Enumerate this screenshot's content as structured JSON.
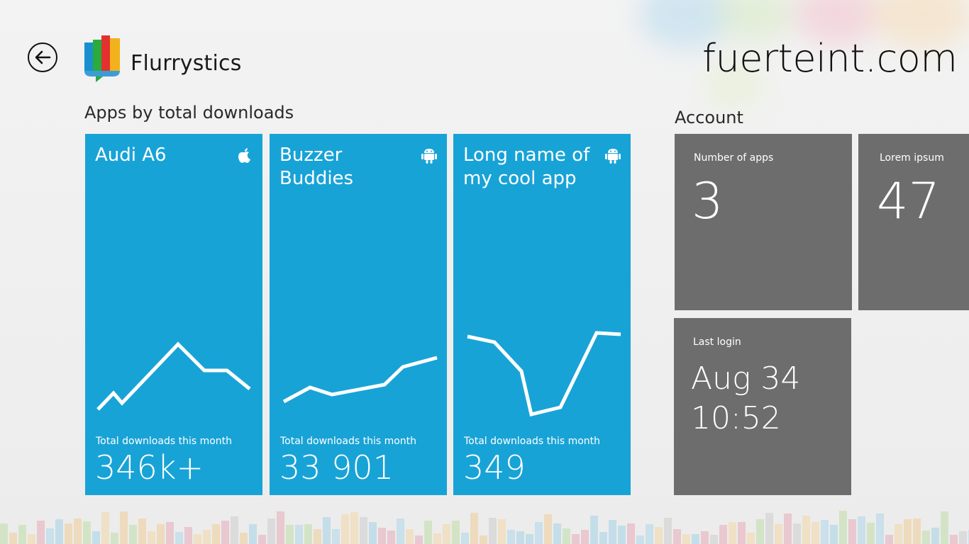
{
  "header": {
    "app_title": "Flurrystics",
    "account": "fuerteint.com"
  },
  "apps_section": {
    "heading": "Apps by total downloads",
    "tiles": [
      {
        "name": "Audi A6",
        "platform": "apple-icon",
        "downloads_label": "Total downloads this month",
        "downloads_value": "346k+"
      },
      {
        "name": "Buzzer Buddies",
        "platform": "android-icon",
        "downloads_label": "Total downloads this month",
        "downloads_value": "33 901"
      },
      {
        "name": "Long name of my cool app",
        "platform": "android-icon",
        "downloads_label": "Total downloads this month",
        "downloads_value": "349"
      }
    ]
  },
  "account_section": {
    "heading": "Account",
    "number_of_apps": {
      "label": "Number of apps",
      "value": "3"
    },
    "lorem_ipsum": {
      "label": "Lorem ipsum",
      "value": "47"
    },
    "last_login": {
      "label": "Last login",
      "value_date": "Aug 34",
      "value_time": "10:52"
    }
  },
  "colors": {
    "tile_blue": "#18a3d7",
    "tile_gray": "#6d6d6d"
  }
}
